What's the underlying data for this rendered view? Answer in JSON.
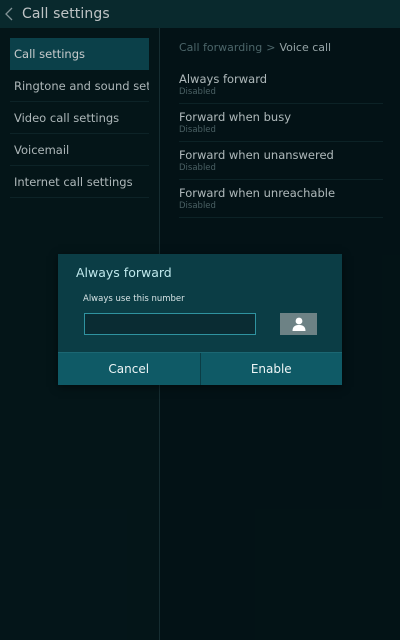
{
  "action_bar": {
    "title": "Call settings"
  },
  "sidebar": {
    "items": [
      {
        "label": "Call settings",
        "selected": true
      },
      {
        "label": "Ringtone and sound setti.."
      },
      {
        "label": "Video call settings"
      },
      {
        "label": "Voicemail"
      },
      {
        "label": "Internet call settings"
      }
    ]
  },
  "breadcrumb": {
    "parent": "Call forwarding",
    "separator": ">",
    "current": "Voice call"
  },
  "options": [
    {
      "title": "Always forward",
      "status": "Disabled"
    },
    {
      "title": "Forward when busy",
      "status": "Disabled"
    },
    {
      "title": "Forward when unanswered",
      "status": "Disabled"
    },
    {
      "title": "Forward when unreachable",
      "status": "Disabled"
    }
  ],
  "dialog": {
    "title": "Always forward",
    "label": "Always use this number",
    "number_value": "",
    "contact_icon": "contact-person-icon",
    "cancel_label": "Cancel",
    "enable_label": "Enable"
  },
  "colors": {
    "accent": "#2f93a0",
    "selected_bg": "#0e4f5a",
    "dialog_bg": "#0b3d45"
  }
}
